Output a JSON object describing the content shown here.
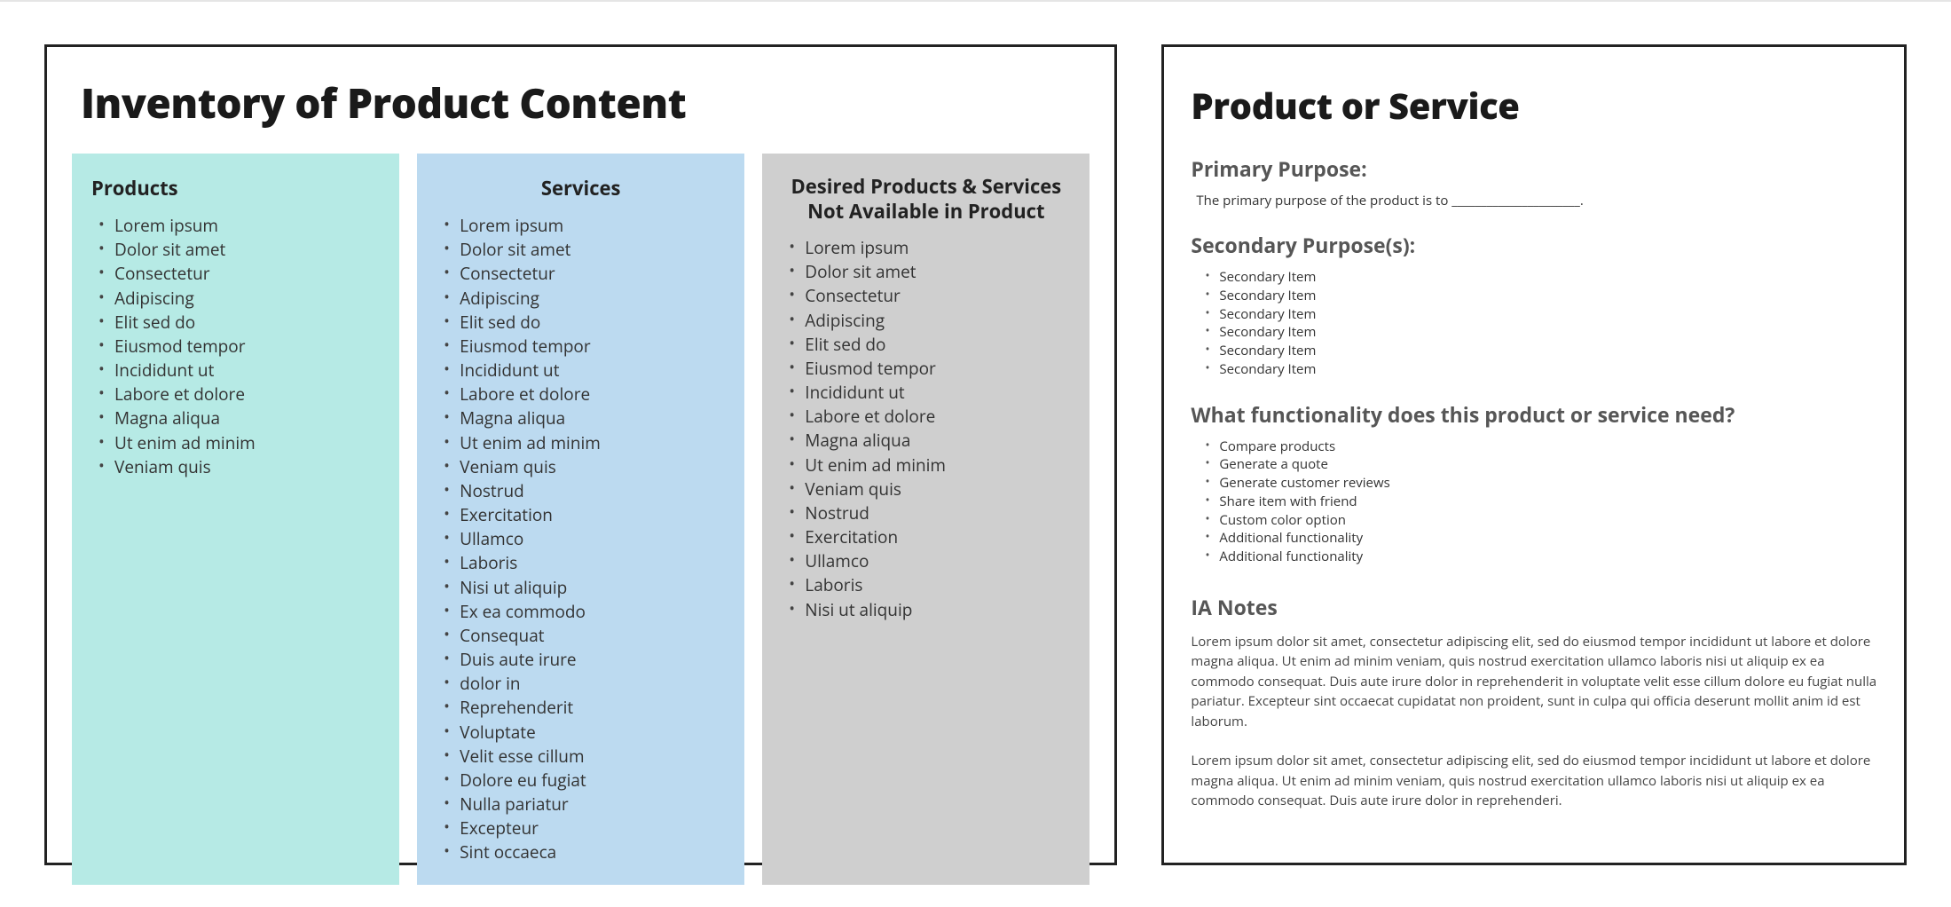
{
  "left": {
    "title": "Inventory of Product Content",
    "columns": [
      {
        "title": "Products",
        "items": [
          "Lorem ipsum",
          "Dolor sit amet",
          "Consectetur",
          "Adipiscing",
          "Elit sed do",
          "Eiusmod tempor",
          "Incididunt ut",
          "Labore et dolore",
          "Magna aliqua",
          "Ut enim ad minim",
          "Veniam quis"
        ]
      },
      {
        "title": "Services",
        "items": [
          "Lorem ipsum",
          "Dolor sit amet",
          "Consectetur",
          "Adipiscing",
          "Elit sed do",
          "Eiusmod tempor",
          "Incididunt ut",
          "Labore et dolore",
          "Magna aliqua",
          "Ut enim ad minim",
          "Veniam quis",
          "Nostrud",
          "Exercitation",
          "Ullamco",
          "Laboris",
          "Nisi ut aliquip",
          "Ex ea commodo",
          "Consequat",
          "Duis aute irure",
          "dolor in",
          "Reprehenderit",
          "Voluptate",
          "Velit esse cillum",
          "Dolore eu fugiat",
          " Nulla pariatur",
          " Excepteur",
          "Sint occaeca"
        ]
      },
      {
        "title": "Desired Products & Services Not Available in Product",
        "items": [
          "Lorem ipsum",
          "Dolor sit amet",
          "Consectetur",
          "Adipiscing",
          "Elit sed do",
          "Eiusmod tempor",
          "Incididunt ut",
          "Labore et dolore",
          "Magna aliqua",
          "Ut enim ad minim",
          "Veniam quis",
          "Nostrud",
          "Exercitation",
          "Ullamco",
          "Laboris",
          "Nisi ut aliquip"
        ]
      }
    ]
  },
  "right": {
    "title": "Product or Service",
    "primary_h": "Primary Purpose:",
    "primary_text": "The primary purpose of the product is to ______________________.",
    "secondary_h": "Secondary Purpose(s):",
    "secondary_items": [
      "Secondary Item",
      "Secondary Item",
      "Secondary Item",
      "Secondary Item",
      "Secondary Item",
      "Secondary Item"
    ],
    "functionality_h": "What functionality does this product or service need?",
    "functionality_items": [
      "Compare products",
      "Generate a quote",
      "Generate customer reviews",
      "Share item with friend",
      "Custom color option",
      "Additional functionality",
      "Additional functionality"
    ],
    "notes_h": "IA Notes",
    "notes_p1": "Lorem ipsum dolor sit amet, consectetur adipiscing elit, sed do eiusmod tempor incididunt ut labore et dolore magna aliqua. Ut enim ad minim veniam, quis nostrud exercitation ullamco laboris nisi ut aliquip ex ea commodo consequat. Duis aute irure dolor in reprehenderit in voluptate velit esse cillum dolore eu fugiat nulla pariatur. Excepteur sint occaecat cupidatat non proident, sunt in culpa qui officia deserunt mollit anim id est laborum.",
    "notes_p2": "Lorem ipsum dolor sit amet, consectetur adipiscing elit, sed do eiusmod tempor incididunt ut labore et dolore magna aliqua. Ut enim ad minim veniam, quis nostrud exercitation ullamco laboris nisi ut aliquip ex ea commodo consequat. Duis aute irure dolor in reprehenderi."
  }
}
